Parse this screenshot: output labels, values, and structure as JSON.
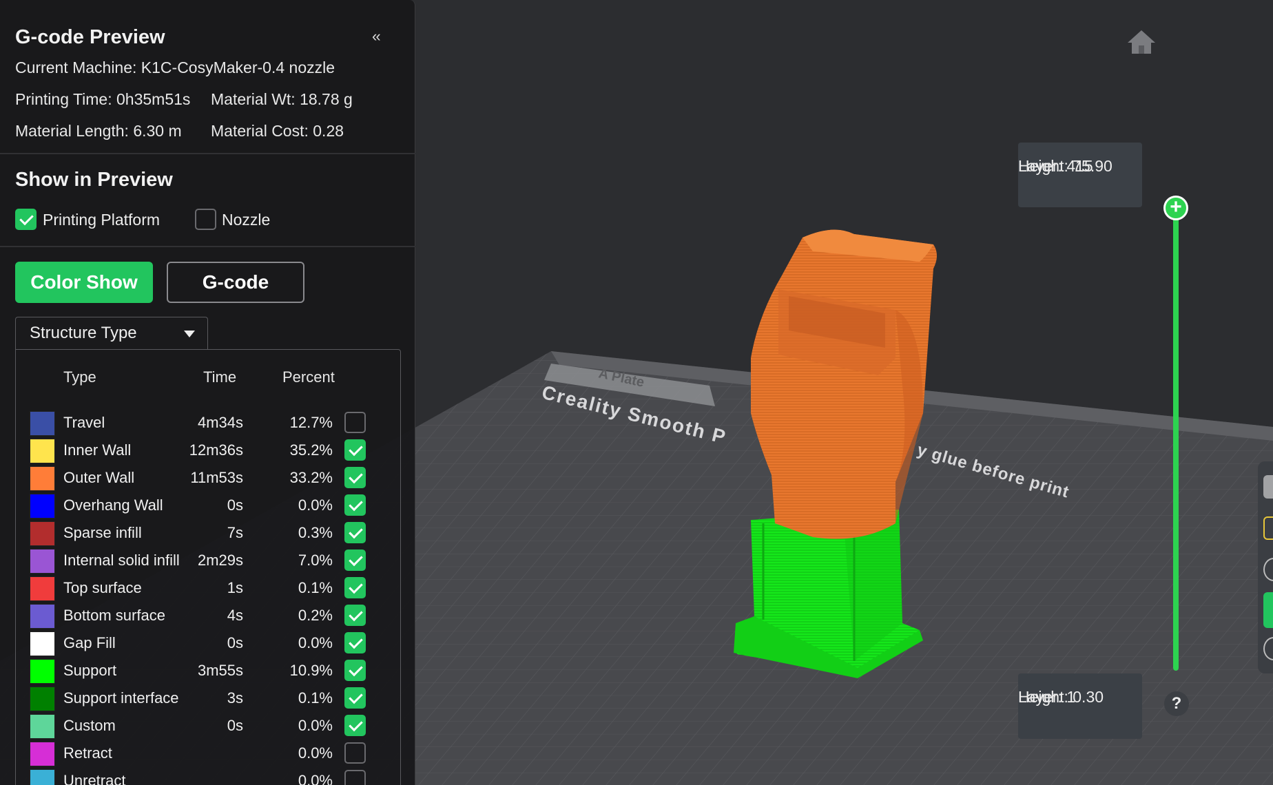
{
  "panel": {
    "title": "G-code Preview",
    "collapse_label": "‹‹",
    "machine": "Current Machine: K1C-CosyMaker-0.4 nozzle",
    "printing_time": "Printing Time: 0h35m51s",
    "material_wt": "Material Wt: 18.78 g",
    "material_length": "Material Length: 6.30 m",
    "material_cost": "Material Cost: 0.28"
  },
  "show_in_preview": {
    "title": "Show in Preview",
    "options": [
      {
        "label": "Printing Platform",
        "checked": true
      },
      {
        "label": "Nozzle",
        "checked": false
      }
    ]
  },
  "mode_buttons": {
    "color_show": "Color Show",
    "gcode": "G-code"
  },
  "dropdown": {
    "selected": "Structure Type"
  },
  "legend": {
    "headers": {
      "type": "Type",
      "time": "Time",
      "percent": "Percent"
    },
    "rows": [
      {
        "name": "Travel",
        "time": "4m34s",
        "percent": "12.7%",
        "color": "#3a4fa6",
        "checked": false
      },
      {
        "name": "Inner Wall",
        "time": "12m36s",
        "percent": "35.2%",
        "color": "#ffe44d",
        "checked": true
      },
      {
        "name": "Outer Wall",
        "time": "11m53s",
        "percent": "33.2%",
        "color": "#ff7d38",
        "checked": true
      },
      {
        "name": "Overhang Wall",
        "time": "0s",
        "percent": "0.0%",
        "color": "#0000ff",
        "checked": true
      },
      {
        "name": "Sparse infill",
        "time": "7s",
        "percent": "0.3%",
        "color": "#b22d2d",
        "checked": true
      },
      {
        "name": "Internal solid infill",
        "time": "2m29s",
        "percent": "7.0%",
        "color": "#9a55d4",
        "checked": true
      },
      {
        "name": "Top surface",
        "time": "1s",
        "percent": "0.1%",
        "color": "#f03c3c",
        "checked": true
      },
      {
        "name": "Bottom surface",
        "time": "4s",
        "percent": "0.2%",
        "color": "#6b5bd1",
        "checked": true
      },
      {
        "name": "Gap Fill",
        "time": "0s",
        "percent": "0.0%",
        "color": "#ffffff",
        "checked": true
      },
      {
        "name": "Support",
        "time": "3m55s",
        "percent": "10.9%",
        "color": "#00ff00",
        "checked": true
      },
      {
        "name": "Support interface",
        "time": "3s",
        "percent": "0.1%",
        "color": "#008000",
        "checked": true
      },
      {
        "name": "Custom",
        "time": "0s",
        "percent": "0.0%",
        "color": "#5ed69a",
        "checked": true
      },
      {
        "name": "Retract",
        "time": "",
        "percent": "0.0%",
        "color": "#d62ed6",
        "checked": false
      },
      {
        "name": "Unretract",
        "time": "",
        "percent": "0.0%",
        "color": "#3ab0d6",
        "checked": false
      }
    ]
  },
  "layer_slider": {
    "top_layer": "Layer: 415",
    "top_height": "Height: 75.90",
    "bottom_layer": "Layer: 1",
    "bottom_height": "Height: 0.30",
    "help": "?"
  },
  "bed": {
    "plate_label": "A Plate",
    "plate_text_1": "Creality Smooth P",
    "plate_text_2": "y glue before print"
  },
  "colors": {
    "accent": "#22c55e",
    "slider": "#2dd350",
    "outer_wall": "#e8772e",
    "support": "#15e81a"
  }
}
